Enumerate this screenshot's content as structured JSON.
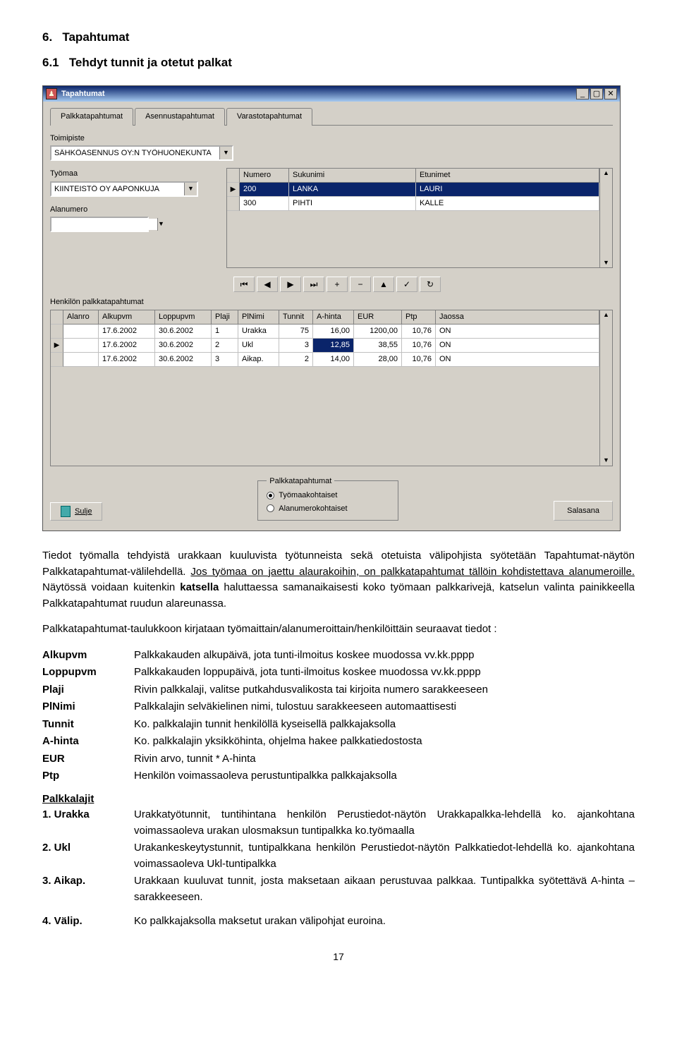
{
  "section": {
    "number": "6.",
    "title": "Tapahtumat",
    "sub_number": "6.1",
    "sub_title": "Tehdyt tunnit ja otetut palkat"
  },
  "window": {
    "title": "Tapahtumat",
    "tabs": [
      "Palkkatapahtumat",
      "Asennustapahtumat",
      "Varastotapahtumat"
    ],
    "toimipiste": {
      "label": "Toimipiste",
      "value": "SÄHKÖASENNUS OY:N TYÖHUONEKUNTA"
    },
    "tyomaa": {
      "label": "Työmaa",
      "value": "KIINTEISTÖ OY AAPONKUJA"
    },
    "alanumero": {
      "label": "Alanumero",
      "value": ""
    },
    "persons": {
      "headers": [
        "Numero",
        "Sukunimi",
        "Etunimet"
      ],
      "rows": [
        {
          "numero": "200",
          "sukunimi": "LANKA",
          "etunimet": "LAURI",
          "selected": true
        },
        {
          "numero": "300",
          "sukunimi": "PIHTI",
          "etunimet": "KALLE",
          "selected": false
        }
      ]
    },
    "detail_label": "Henkilön palkkatapahtumat",
    "detail": {
      "headers": [
        "Alanro",
        "Alkupvm",
        "Loppupvm",
        "Plaji",
        "PlNimi",
        "Tunnit",
        "A-hinta",
        "EUR",
        "Ptp",
        "Jaossa"
      ],
      "rows": [
        {
          "alanro": "",
          "alkupvm": "17.6.2002",
          "loppupvm": "30.6.2002",
          "plaji": "1",
          "plnimi": "Urakka",
          "tunnit": "75",
          "ahinta": "16,00",
          "eur": "1200,00",
          "ptp": "10,76",
          "jaossa": "ON"
        },
        {
          "alanro": "",
          "alkupvm": "17.6.2002",
          "loppupvm": "30.6.2002",
          "plaji": "2",
          "plnimi": "Ukl",
          "tunnit": "3",
          "ahinta": "12,85",
          "eur": "38,55",
          "ptp": "10,76",
          "jaossa": "ON",
          "editing": "ahinta"
        },
        {
          "alanro": "",
          "alkupvm": "17.6.2002",
          "loppupvm": "30.6.2002",
          "plaji": "3",
          "plnimi": "Aikap.",
          "tunnit": "2",
          "ahinta": "14,00",
          "eur": "28,00",
          "ptp": "10,76",
          "jaossa": "ON"
        }
      ]
    },
    "nav": [
      "⏮",
      "◀",
      "▶",
      "⏭",
      "+",
      "−",
      "▲",
      "✓",
      "↻"
    ],
    "radio": {
      "title": "Palkkatapahtumat",
      "opt1": "Työmaakohtaiset",
      "opt2": "Alanumerokohtaiset"
    },
    "sulje": "Sulje",
    "salasana": "Salasana"
  },
  "paras": {
    "p1": "Tiedot työmalla tehdyistä urakkaan kuuluvista työtunneista sekä otetuista välipohjista syötetään Tapahtumat-näytön Palkkatapahtumat-välilehdellä. ",
    "p1_u": "Jos työmaa on jaettu alaurakoihin, on palkkatapahtumat tällöin kohdistettava alanumeroille.",
    "p1_c": " Näytössä voidaan kuitenkin ",
    "p1_b": "katsella",
    "p1_d": " haluttaessa samanaikaisesti koko työmaan palkkarivejä, katselun valinta painikkeella Palkkatapahtumat ruudun alareunassa.",
    "p2": "Palkkatapahtumat-taulukkoon kirjataan työmaittain/alanumeroittain/henkilöittäin seuraavat tiedot :"
  },
  "fields": [
    {
      "term": "Alkupvm",
      "desc": "Palkkakauden alkupäivä, jota tunti-ilmoitus koskee muodossa vv.kk.pppp"
    },
    {
      "term": "Loppupvm",
      "desc": "Palkkakauden loppupäivä, jota tunti-ilmoitus koskee muodossa vv.kk.pppp"
    },
    {
      "term": "Plaji",
      "desc": "Rivin palkkalaji, valitse putkahdusvalikosta tai kirjoita numero sarakkeeseen"
    },
    {
      "term": "PlNimi",
      "desc": "Palkkalajin selväkielinen nimi, tulostuu sarakkeeseen automaattisesti"
    },
    {
      "term": "Tunnit",
      "desc": "Ko. palkkalajin tunnit henkilöllä kyseisellä palkkajaksolla"
    },
    {
      "term": "A-hinta",
      "desc": "Ko. palkkalajin yksikköhinta, ohjelma hakee palkkatiedostosta"
    },
    {
      "term": "EUR",
      "desc": "Rivin arvo, tunnit * A-hinta"
    },
    {
      "term": "Ptp",
      "desc": "Henkilön voimassaoleva perustuntipalkka palkkajaksolla"
    }
  ],
  "palkkalajit": {
    "title": "Palkkalajit",
    "items": [
      {
        "term": "1. Urakka",
        "desc": "Urakkatyötunnit, tuntihintana henkilön Perustiedot-näytön Urakkapalkka-lehdellä ko. ajankohtana voimassaoleva urakan ulosmaksun tuntipalkka ko.työmaalla"
      },
      {
        "term": "2. Ukl",
        "desc": "Urakankeskeytystunnit, tuntipalkkana henkilön Perustiedot-näytön Palkkatiedot-lehdellä ko. ajankohtana voimassaoleva Ukl-tuntipalkka"
      },
      {
        "term": "3. Aikap.",
        "desc": "Urakkaan kuuluvat tunnit, josta maksetaan aikaan perustuvaa palkkaa. Tuntipalkka syötettävä A-hinta –sarakkeeseen."
      },
      {
        "term": "4. Välip.",
        "desc": "Ko palkkajaksolla maksetut urakan välipohjat euroina."
      }
    ]
  },
  "page_number": "17"
}
